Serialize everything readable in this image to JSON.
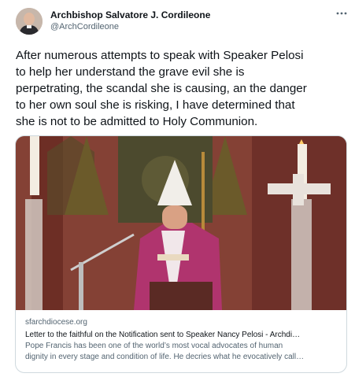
{
  "author": {
    "name": "Archbishop Salvatore J. Cordileone",
    "handle": "@ArchCordileone"
  },
  "more_icon": "more-horizontal-icon",
  "tweet": {
    "lines": [
      "After numerous attempts to speak with Speaker Pelosi",
      "to help her understand the grave evil she is",
      "perpetrating, the scandal she is causing, an the danger",
      "to her own soul she is risking, I have determined that",
      "she is not to be admitted to Holy Communion."
    ]
  },
  "card": {
    "domain": "sfarchdiocese.org",
    "title": "Letter to the faithful on the Notification sent to Speaker Nancy Pelosi - Archdi…",
    "description": "Pope Francis has been one of the world’s most vocal advocates of human",
    "description2": "dignity in every stage and condition of life.  He decries what he evocatively call…"
  },
  "colors": {
    "text": "#0f1419",
    "secondary": "#536471",
    "border": "#cfd9de",
    "vestment": "#b0346e"
  }
}
